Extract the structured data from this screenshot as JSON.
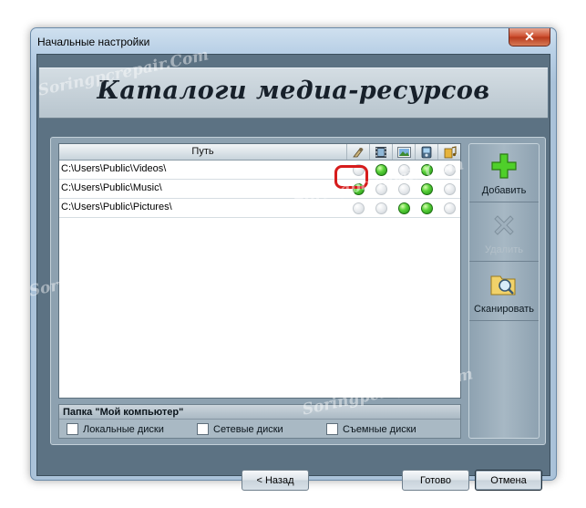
{
  "window": {
    "title": "Начальные настройки",
    "close_glyph": "✕"
  },
  "header": {
    "title": "Каталоги медиа-ресурсов"
  },
  "table": {
    "path_header": "Путь",
    "column_icons": [
      "video-camera-icon",
      "film-icon",
      "picture-icon",
      "device-icon",
      "music-icon"
    ],
    "rows": [
      {
        "path": "C:\\Users\\Public\\Videos\\",
        "flags": [
          false,
          true,
          false,
          true,
          false
        ]
      },
      {
        "path": "C:\\Users\\Public\\Music\\",
        "flags": [
          true,
          false,
          false,
          true,
          false
        ]
      },
      {
        "path": "C:\\Users\\Public\\Pictures\\",
        "flags": [
          false,
          false,
          true,
          true,
          false
        ]
      }
    ]
  },
  "side_buttons": {
    "add": "Добавить",
    "remove": "Удалить",
    "scan": "Сканировать"
  },
  "my_computer": {
    "title": "Папка \"Мой компьютер\"",
    "options": [
      {
        "label": "Локальные диски",
        "checked": false
      },
      {
        "label": "Сетевые диски",
        "checked": false
      },
      {
        "label": "Съемные диски",
        "checked": false
      }
    ]
  },
  "buttons": {
    "back": "< Назад",
    "done": "Готово",
    "cancel": "Отмена"
  },
  "watermark": "Soringpcrepair.Com",
  "colors": {
    "accent_highlight": "#d61c1c",
    "dot_on": "#3fbf22",
    "header_dark": "#5c7283"
  }
}
